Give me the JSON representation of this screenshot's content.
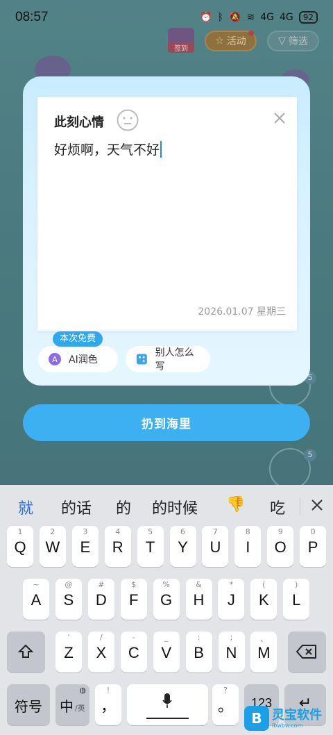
{
  "status": {
    "time": "08:57",
    "battery": "92",
    "net1": "4G",
    "net2": "4G"
  },
  "background": {
    "gift_label": "签到",
    "activity_label": "活动",
    "filter_label": "筛选",
    "badge_5a": "5",
    "badge_5b": "5"
  },
  "mood_card": {
    "title": "此刻心情",
    "text": "好烦啊，天气不好",
    "date": "2026.01.07 星期三",
    "free_badge": "本次免费",
    "ai_polish_label": "AI润色",
    "others_label": "别人怎么写"
  },
  "throw_button": "扔到海里",
  "keyboard": {
    "candidates": [
      "就",
      "的话",
      "的",
      "的时候",
      "👎",
      "吃"
    ],
    "row1": [
      {
        "sub": "1",
        "key": "Q"
      },
      {
        "sub": "2",
        "key": "W"
      },
      {
        "sub": "3",
        "key": "E"
      },
      {
        "sub": "4",
        "key": "R"
      },
      {
        "sub": "5",
        "key": "T"
      },
      {
        "sub": "6",
        "key": "Y"
      },
      {
        "sub": "7",
        "key": "U"
      },
      {
        "sub": "8",
        "key": "I"
      },
      {
        "sub": "9",
        "key": "O"
      },
      {
        "sub": "0",
        "key": "P"
      }
    ],
    "row2": [
      {
        "sub": "~",
        "key": "A"
      },
      {
        "sub": "@",
        "key": "S"
      },
      {
        "sub": "#",
        "key": "D"
      },
      {
        "sub": "$",
        "key": "F"
      },
      {
        "sub": "%",
        "key": "G"
      },
      {
        "sub": "&",
        "key": "H"
      },
      {
        "sub": "*",
        "key": "J"
      },
      {
        "sub": "(",
        "key": "K"
      },
      {
        "sub": ")",
        "key": "L"
      }
    ],
    "row3": [
      {
        "sub": "'",
        "key": "Z"
      },
      {
        "sub": "/",
        "key": "X"
      },
      {
        "sub": "-",
        "key": "C"
      },
      {
        "sub": "_",
        "key": "V"
      },
      {
        "sub": ":",
        "key": "B"
      },
      {
        "sub": ";",
        "key": "N"
      },
      {
        "sub": "、",
        "key": "M"
      }
    ],
    "symbols_label": "符号",
    "lang_label": "中",
    "lang_sub": "/英",
    "comma_sub": "!",
    "comma_key": "，",
    "period_sub": "?",
    "period_key": "。",
    "num_label": "123"
  },
  "watermark": {
    "brand": "灵宝软件",
    "url": "lbwbw.com"
  }
}
